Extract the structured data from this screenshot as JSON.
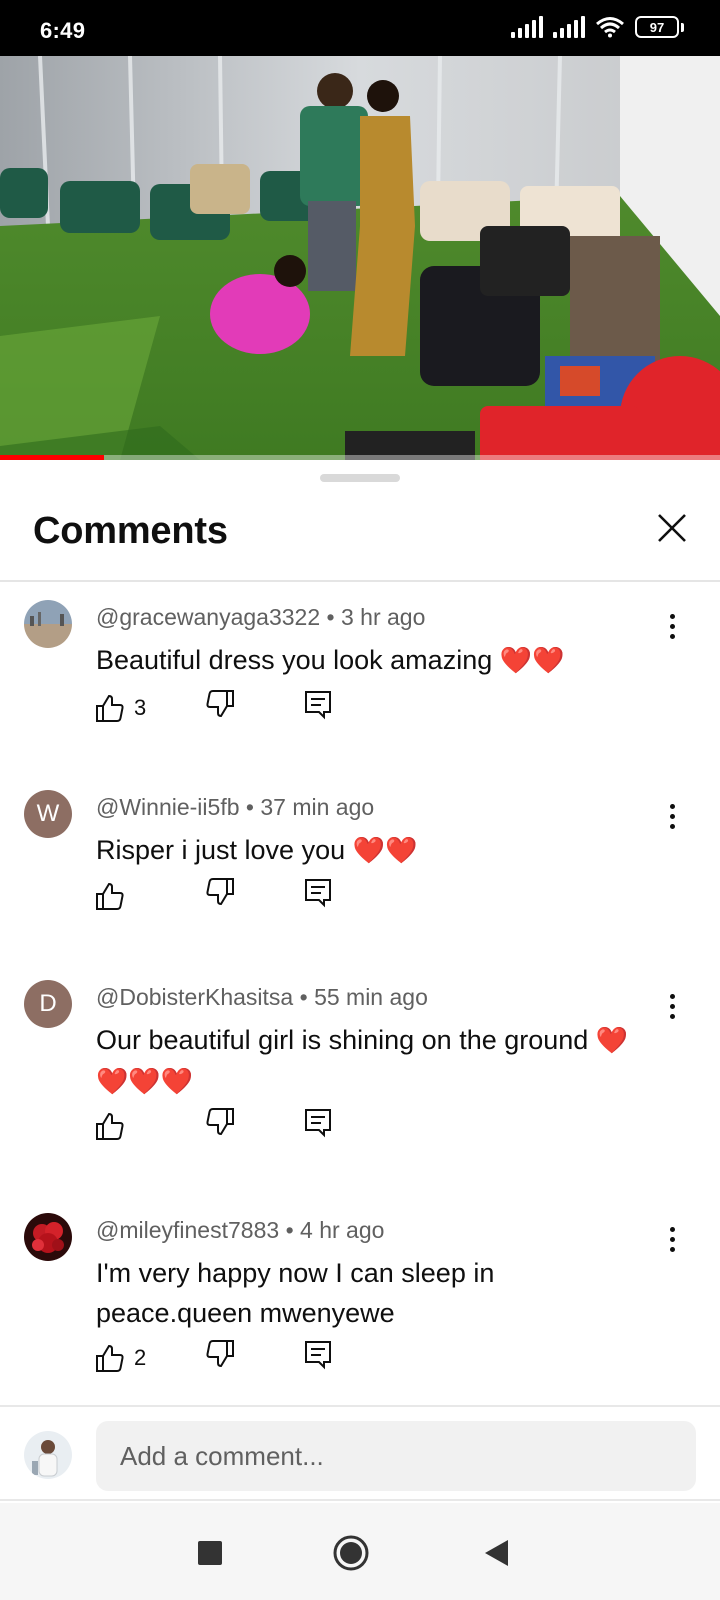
{
  "status_bar": {
    "time": "6:49",
    "battery": "97"
  },
  "video": {
    "progress": 0.145,
    "accent_color": "#ff0000"
  },
  "sheet": {
    "title": "Comments"
  },
  "comments": [
    {
      "author": "@gracewanyaga3322",
      "time": "3 hr ago",
      "text": "Beautiful dress you look amazing",
      "hearts": "❤️❤️",
      "likes": "3",
      "avatar": "photo"
    },
    {
      "author": "@Winnie-ii5fb",
      "time": "37 min ago",
      "text": "Risper i just love you",
      "hearts": "❤️❤️",
      "likes": "",
      "avatar_letter": "W",
      "avatar_color": "#8d6e63"
    },
    {
      "author": "@DobisterKhasitsa",
      "time": "55 min ago",
      "text": "Our beautiful girl is shining on the ground",
      "hearts": "❤️ ❤️❤️❤️",
      "likes": "",
      "avatar_letter": "D",
      "avatar_color": "#8d6e63"
    },
    {
      "author": "@mileyfinest7883",
      "time": "4 hr ago",
      "text": "I'm very happy now I can sleep in peace.queen mwenyewe",
      "hearts": "",
      "likes": "2",
      "avatar": "photo"
    }
  ],
  "compose": {
    "placeholder": "Add a comment..."
  }
}
